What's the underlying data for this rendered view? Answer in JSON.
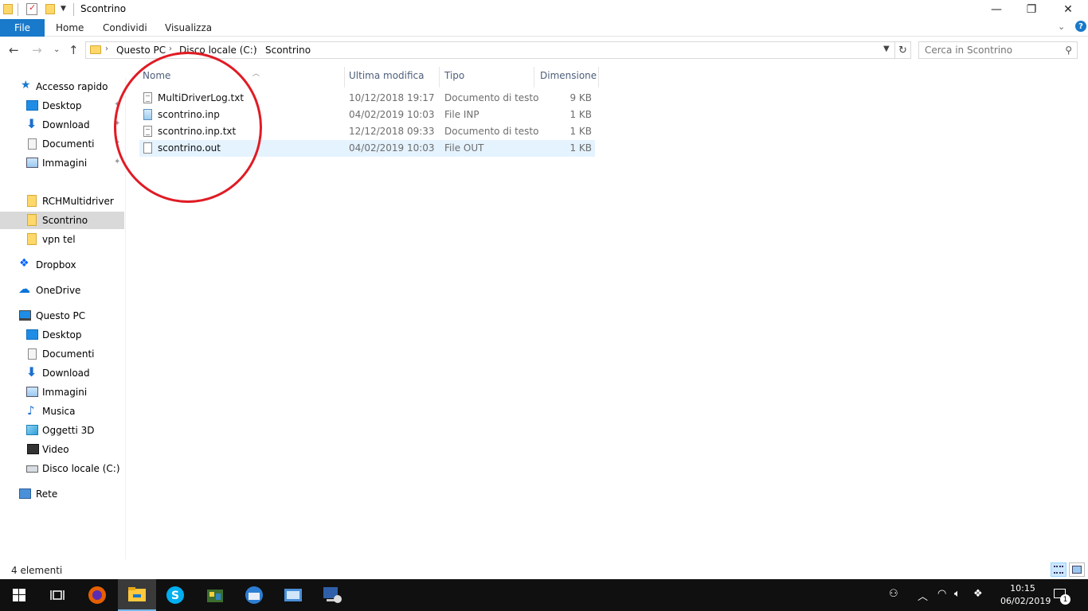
{
  "window": {
    "title": "Scontrino",
    "controls": {
      "minimize": "—",
      "maximize": "❐",
      "close": "✕"
    }
  },
  "ribbon": {
    "tabs": [
      "File",
      "Home",
      "Condividi",
      "Visualizza"
    ],
    "help": "?"
  },
  "address": {
    "crumbs": [
      "Questo PC",
      "Disco locale (C:)",
      "Scontrino"
    ],
    "separator": "›"
  },
  "search": {
    "placeholder": "Cerca in Scontrino"
  },
  "sidebar": {
    "items": [
      {
        "label": "Accesso rapido",
        "icon": "star-icon"
      },
      {
        "label": "Desktop",
        "icon": "desktop-icon",
        "pinned": true
      },
      {
        "label": "Download",
        "icon": "download-icon",
        "pinned": true
      },
      {
        "label": "Documenti",
        "icon": "documents-icon",
        "pinned": true
      },
      {
        "label": "Immagini",
        "icon": "pictures-icon",
        "pinned": true
      },
      {
        "label": "RCHMultidriver",
        "icon": "folder-icon"
      },
      {
        "label": "Scontrino",
        "icon": "folder-icon",
        "selected": true
      },
      {
        "label": "vpn tel",
        "icon": "folder-icon"
      },
      {
        "label": "Dropbox",
        "icon": "dropbox-icon"
      },
      {
        "label": "OneDrive",
        "icon": "onedrive-icon"
      },
      {
        "label": "Questo PC",
        "icon": "computer-icon"
      },
      {
        "label": "Desktop",
        "icon": "desktop-icon"
      },
      {
        "label": "Documenti",
        "icon": "documents-icon"
      },
      {
        "label": "Download",
        "icon": "download-icon"
      },
      {
        "label": "Immagini",
        "icon": "pictures-icon"
      },
      {
        "label": "Musica",
        "icon": "music-icon"
      },
      {
        "label": "Oggetti 3D",
        "icon": "3d-objects-icon"
      },
      {
        "label": "Video",
        "icon": "video-icon"
      },
      {
        "label": "Disco locale (C:)",
        "icon": "drive-icon"
      },
      {
        "label": "Rete",
        "icon": "network-icon"
      }
    ]
  },
  "filelist": {
    "columns": [
      "Nome",
      "Ultima modifica",
      "Tipo",
      "Dimensione"
    ],
    "rows": [
      {
        "name": "MultiDriverLog.txt",
        "modified": "10/12/2018 19:17",
        "type": "Documento di testo",
        "size": "9 KB",
        "icon": "text-file-icon"
      },
      {
        "name": "scontrino.inp",
        "modified": "04/02/2019 10:03",
        "type": "File INP",
        "size": "1 KB",
        "icon": "inp-file-icon"
      },
      {
        "name": "scontrino.inp.txt",
        "modified": "12/12/2018 09:33",
        "type": "Documento di testo",
        "size": "1 KB",
        "icon": "text-file-icon"
      },
      {
        "name": "scontrino.out",
        "modified": "04/02/2019 10:03",
        "type": "File OUT",
        "size": "1 KB",
        "icon": "generic-file-icon",
        "selected": true
      }
    ]
  },
  "status": {
    "count": "4 elementi"
  },
  "taskbar": {
    "time": "10:15",
    "date": "06/02/2019",
    "notifications": "1",
    "accent": "#76b9ed"
  }
}
